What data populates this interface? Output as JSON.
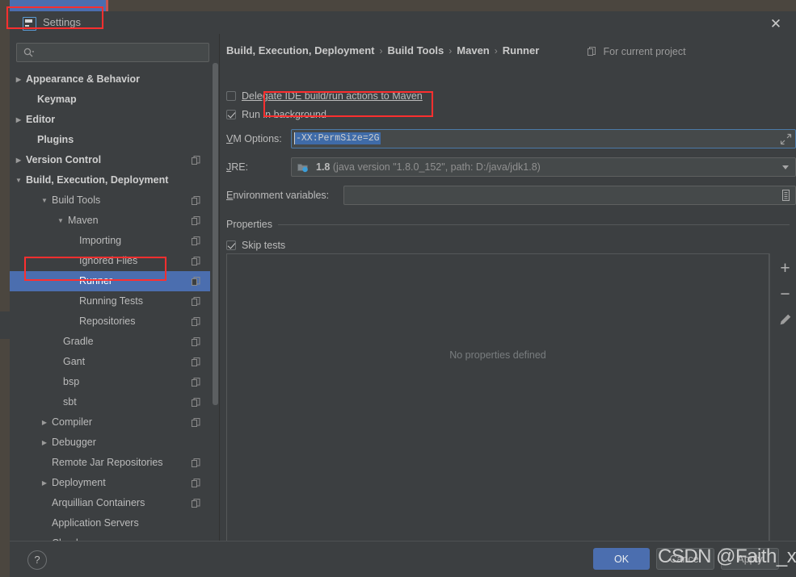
{
  "window": {
    "title": "Settings",
    "icon": "idea-settings-icon",
    "close_label": "✕"
  },
  "sidebar": {
    "search": {
      "placeholder": "",
      "value": "",
      "icon": "search-icon"
    },
    "items": [
      {
        "label": "Appearance & Behavior",
        "indent": 20,
        "twisty": "▶",
        "bold": true,
        "project_icon": false,
        "selected": false
      },
      {
        "label": "Keymap",
        "indent": 34,
        "twisty": "",
        "bold": true,
        "project_icon": false,
        "selected": false
      },
      {
        "label": "Editor",
        "indent": 20,
        "twisty": "▶",
        "bold": true,
        "project_icon": false,
        "selected": false
      },
      {
        "label": "Plugins",
        "indent": 34,
        "twisty": "",
        "bold": true,
        "project_icon": false,
        "selected": false
      },
      {
        "label": "Version Control",
        "indent": 20,
        "twisty": "▶",
        "bold": true,
        "project_icon": true,
        "selected": false
      },
      {
        "label": "Build, Execution, Deployment",
        "indent": 20,
        "twisty": "▼",
        "bold": true,
        "project_icon": false,
        "selected": false
      },
      {
        "label": "Build Tools",
        "indent": 52,
        "twisty": "▼",
        "bold": false,
        "project_icon": true,
        "selected": false
      },
      {
        "label": "Maven",
        "indent": 72,
        "twisty": "▼",
        "bold": false,
        "project_icon": true,
        "selected": false
      },
      {
        "label": "Importing",
        "indent": 86,
        "twisty": "",
        "bold": false,
        "project_icon": true,
        "selected": false
      },
      {
        "label": "Ignored Files",
        "indent": 86,
        "twisty": "",
        "bold": false,
        "project_icon": true,
        "selected": false
      },
      {
        "label": "Runner",
        "indent": 86,
        "twisty": "",
        "bold": false,
        "project_icon": true,
        "selected": true
      },
      {
        "label": "Running Tests",
        "indent": 86,
        "twisty": "",
        "bold": false,
        "project_icon": true,
        "selected": false
      },
      {
        "label": "Repositories",
        "indent": 86,
        "twisty": "",
        "bold": false,
        "project_icon": true,
        "selected": false
      },
      {
        "label": "Gradle",
        "indent": 66,
        "twisty": "",
        "bold": false,
        "project_icon": true,
        "selected": false
      },
      {
        "label": "Gant",
        "indent": 66,
        "twisty": "",
        "bold": false,
        "project_icon": true,
        "selected": false
      },
      {
        "label": "bsp",
        "indent": 66,
        "twisty": "",
        "bold": false,
        "project_icon": true,
        "selected": false
      },
      {
        "label": "sbt",
        "indent": 66,
        "twisty": "",
        "bold": false,
        "project_icon": true,
        "selected": false
      },
      {
        "label": "Compiler",
        "indent": 52,
        "twisty": "▶",
        "bold": false,
        "project_icon": true,
        "selected": false
      },
      {
        "label": "Debugger",
        "indent": 52,
        "twisty": "▶",
        "bold": false,
        "project_icon": false,
        "selected": false
      },
      {
        "label": "Remote Jar Repositories",
        "indent": 52,
        "twisty": "",
        "bold": false,
        "project_icon": true,
        "selected": false
      },
      {
        "label": "Deployment",
        "indent": 52,
        "twisty": "▶",
        "bold": false,
        "project_icon": true,
        "selected": false
      },
      {
        "label": "Arquillian Containers",
        "indent": 52,
        "twisty": "",
        "bold": false,
        "project_icon": true,
        "selected": false
      },
      {
        "label": "Application Servers",
        "indent": 52,
        "twisty": "",
        "bold": false,
        "project_icon": false,
        "selected": false
      },
      {
        "label": "Clouds",
        "indent": 52,
        "twisty": "",
        "bold": false,
        "project_icon": false,
        "selected": false
      }
    ]
  },
  "main": {
    "breadcrumb": [
      "Build, Execution, Deployment",
      "Build Tools",
      "Maven",
      "Runner"
    ],
    "breadcrumb_separator": "›",
    "for_current_project": "For current project",
    "checkboxes": [
      {
        "label": "Delegate IDE build/run actions to Maven",
        "checked": false,
        "mnemonic": "D"
      },
      {
        "label": "Run in background",
        "checked": true,
        "mnemonic": "b"
      }
    ],
    "vm_options": {
      "label": "VM Options:",
      "value": "-XX:PermSize=2G",
      "selected": true,
      "expand_icon": "expand-arrows-icon"
    },
    "jre": {
      "label": "JRE:",
      "version": "1.8",
      "description": "(java version \"1.8.0_152\", path: D:/java/jdk1.8)",
      "icon": "jdk-folder-icon"
    },
    "environment_variables": {
      "label": "Environment variables:",
      "value": "",
      "browse_icon": "list-editor-icon"
    },
    "properties": {
      "section_title": "Properties",
      "skip_tests": {
        "label": "Skip tests",
        "checked": true,
        "mnemonic": "t"
      },
      "empty_text": "No properties defined",
      "toolbar": [
        {
          "name": "add-property-button",
          "glyph": "+"
        },
        {
          "name": "remove-property-button",
          "glyph": "−"
        },
        {
          "name": "edit-property-button",
          "glyph": "pencil-icon"
        }
      ]
    }
  },
  "footer": {
    "help": "?",
    "ok": "OK",
    "cancel": "Cancel",
    "apply": "Apply"
  },
  "watermark": "CSDN @Faith_xzc",
  "annotations": [
    {
      "name": "annotation-title",
      "color": "#fe2f2f"
    },
    {
      "name": "annotation-runner",
      "color": "#fe2f2f"
    },
    {
      "name": "annotation-vm-options",
      "color": "#fe2f2f"
    }
  ],
  "colors": {
    "dialog_bg": "#3c3f41",
    "selection_blue": "#4b6eaf",
    "annotation_red": "#fe2f2f",
    "field_bg": "#45494a",
    "text": "#bbbbbb"
  }
}
